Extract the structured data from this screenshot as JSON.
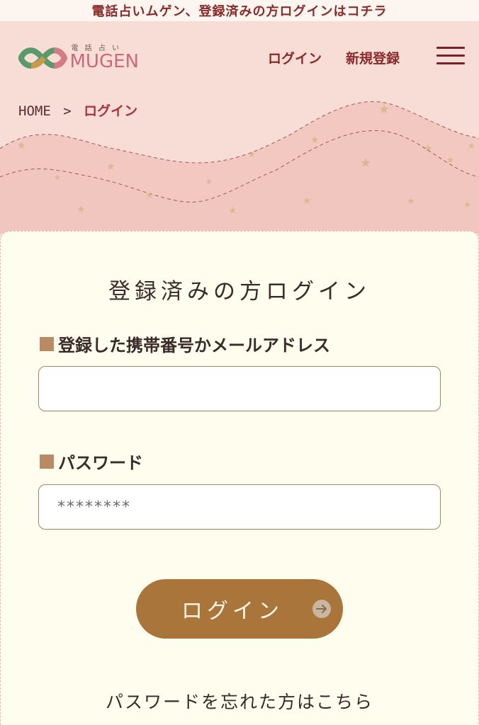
{
  "banner": {
    "text": "電話占いムゲン、登録済みの方ログインはコチラ"
  },
  "logo": {
    "sub": "電 話 占 い",
    "main": "MUGEN"
  },
  "nav": {
    "login": "ログイン",
    "register": "新規登録"
  },
  "breadcrumb": {
    "home": "HOME",
    "separator": ">",
    "current": "ログイン"
  },
  "form": {
    "title": "登録済みの方ログイン",
    "id_label": "登録した携帯番号かメールアドレス",
    "id_value": "",
    "password_label": "パスワード",
    "password_value": "********",
    "submit": "ログイン",
    "forgot": "パスワードを忘れた方はこちら"
  },
  "colors": {
    "accent": "#8a2a2a",
    "button": "#a9753b",
    "card": "#fffdee",
    "header": "#f7ddd6"
  }
}
